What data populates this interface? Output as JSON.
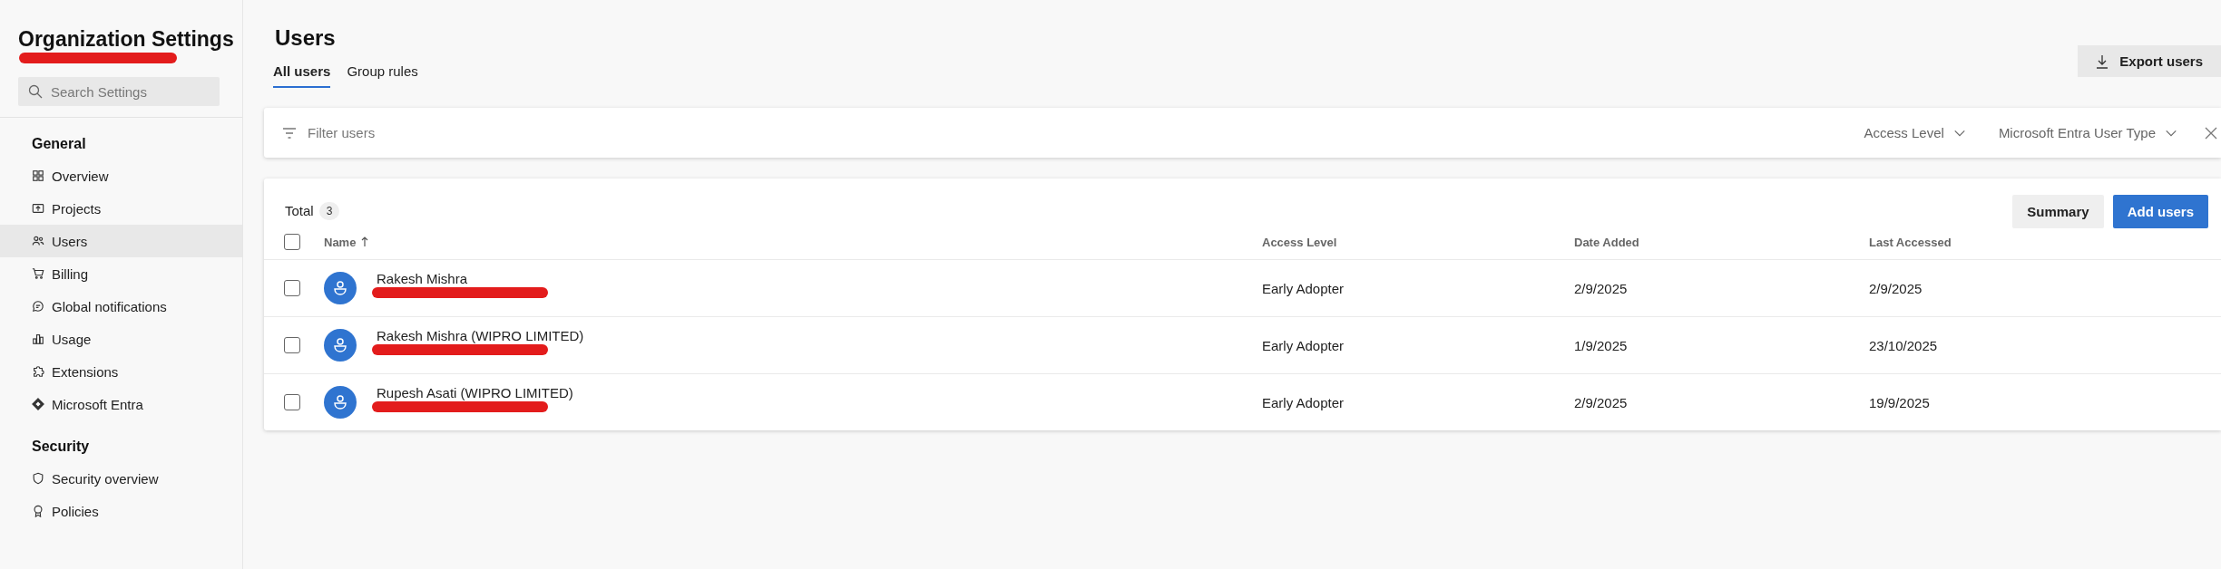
{
  "sidebar": {
    "title": "Organization Settings",
    "title_redacted": true,
    "search": {
      "placeholder": "Search Settings"
    },
    "sections": [
      {
        "heading": "General",
        "items": [
          {
            "label": "Overview",
            "selected": false
          },
          {
            "label": "Projects",
            "selected": false
          },
          {
            "label": "Users",
            "selected": true
          },
          {
            "label": "Billing",
            "selected": false
          },
          {
            "label": "Global notifications",
            "selected": false
          },
          {
            "label": "Usage",
            "selected": false
          },
          {
            "label": "Extensions",
            "selected": false
          },
          {
            "label": "Microsoft Entra",
            "selected": false
          }
        ]
      },
      {
        "heading": "Security",
        "items": [
          {
            "label": "Security overview",
            "selected": false
          },
          {
            "label": "Policies",
            "selected": false
          }
        ]
      }
    ]
  },
  "page": {
    "title": "Users",
    "tabs": [
      {
        "label": "All users",
        "selected": true
      },
      {
        "label": "Group rules",
        "selected": false
      }
    ],
    "export_button": "Export users",
    "filter": {
      "placeholder": "Filter users",
      "dropdowns": [
        "Access Level",
        "Microsoft Entra User Type"
      ]
    },
    "table": {
      "total_label": "Total",
      "total_count": "3",
      "buttons": [
        {
          "label": "Summary",
          "kind": "secondary"
        },
        {
          "label": "Add users",
          "kind": "primary"
        }
      ],
      "select_all_checked": false,
      "columns": [
        "Name",
        "Access Level",
        "Date Added",
        "Last Accessed"
      ],
      "rows": [
        {
          "name": "Rakesh Mishra",
          "redacted": true,
          "checked": false,
          "access_level": "Early Adopter",
          "date_added": "2/9/2025",
          "last_accessed": "2/9/2025"
        },
        {
          "name": "Rakesh Mishra (WIPRO LIMITED)",
          "redacted": true,
          "checked": false,
          "access_level": "Early Adopter",
          "date_added": "1/9/2025",
          "last_accessed": "23/10/2025"
        },
        {
          "name": "Rupesh Asati (WIPRO LIMITED)",
          "redacted": true,
          "checked": false,
          "access_level": "Early Adopter",
          "date_added": "2/9/2025",
          "last_accessed": "19/9/2025"
        }
      ]
    }
  }
}
